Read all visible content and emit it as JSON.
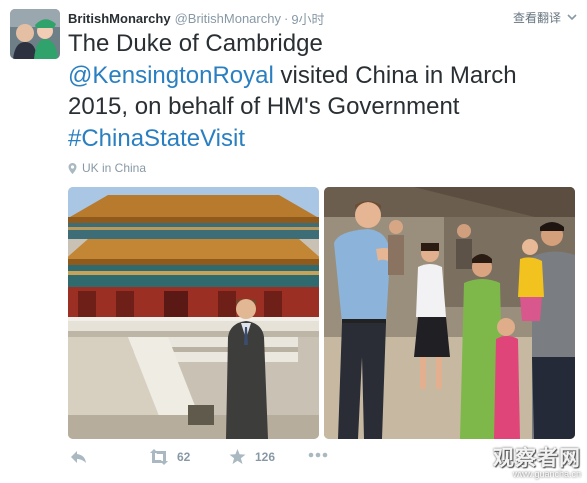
{
  "tweet": {
    "author": {
      "fullname": "BritishMonarchy",
      "handle": "@BritishMonarchy",
      "separator": "·",
      "time": "9小时"
    },
    "translate_label": "查看翻译",
    "text": {
      "part1": "The Duke of Cambridge",
      "mention": "@KensingtonRoyal",
      "part2": " visited China in March 2015, on behalf of HM's Government",
      "hashtag": "#ChinaStateVisit"
    },
    "place": "UK in China",
    "actions": {
      "retweet_count": "62",
      "favorite_count": "126"
    }
  },
  "watermark": {
    "main": "观察者网",
    "url": "www.guancha.cn"
  },
  "colors": {
    "link": "#2a7fc1",
    "meta": "#8899a6",
    "text": "#292f33"
  },
  "icons": [
    "avatar",
    "caret-down-icon",
    "location-pin-icon",
    "reply-icon",
    "retweet-icon",
    "star-icon",
    "more-icon"
  ]
}
